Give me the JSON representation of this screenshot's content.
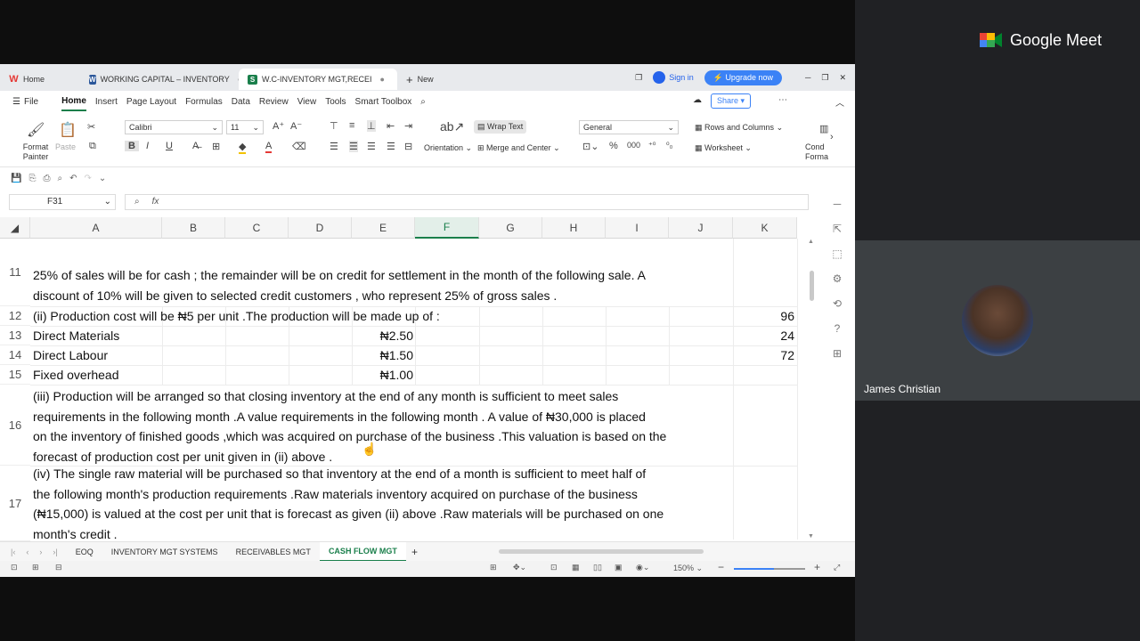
{
  "meet": {
    "brand": "Google Meet",
    "participant_name": "James Christian"
  },
  "browser": {
    "tabs": [
      {
        "label": "Home",
        "badge": "W",
        "color": "#e53935"
      },
      {
        "label": "WORKING CAPITAL – INVENTORY",
        "badge": "W",
        "color": "#2b579a"
      },
      {
        "label": "W.C-INVENTORY MGT,RECEI",
        "badge": "S",
        "color": "#1a7f4b"
      }
    ],
    "new_tab": "New",
    "sign_in": "Sign in",
    "upgrade": "Upgrade now"
  },
  "menu": {
    "file": "File",
    "items": [
      "Home",
      "Insert",
      "Page Layout",
      "Formulas",
      "Data",
      "Review",
      "View",
      "Tools",
      "Smart Toolbox"
    ],
    "share": "Share"
  },
  "ribbon": {
    "format_painter": "Format Painter",
    "paste": "Paste",
    "font_name": "Calibri",
    "font_size": "11",
    "wrap_text": "Wrap Text",
    "orientation": "Orientation",
    "merge_center": "Merge and Center",
    "number_format": "General",
    "rows_columns": "Rows and Columns",
    "worksheet": "Worksheet",
    "cond_format": "Cond Forma"
  },
  "formula_bar": {
    "cell_ref": "F31",
    "fx": "fx",
    "value": ""
  },
  "columns": [
    "A",
    "B",
    "C",
    "D",
    "E",
    "F",
    "G",
    "H",
    "I",
    "J",
    "K"
  ],
  "selected_column": "F",
  "rows": {
    "r11": {
      "num": "11",
      "lines": [
        "25% of sales will be for cash ; the remainder will be on credit for settlement in the month of the  following sale. A",
        "discount of 10% will be given to selected credit customers , who represent 25% of gross sales ."
      ]
    },
    "r12": {
      "num": "12",
      "a": "(ii) Production cost will be ₦5 per unit .The production will be made up of :",
      "k": "96"
    },
    "r13": {
      "num": "13",
      "a": "Direct Materials",
      "e": "₦2.50",
      "k": "24"
    },
    "r14": {
      "num": "14",
      "a": "Direct Labour",
      "e": "₦1.50",
      "k": "72"
    },
    "r15": {
      "num": "15",
      "a": "Fixed overhead",
      "e": "₦1.00"
    },
    "r16": {
      "num": "16",
      "lines": [
        "(iii) Production will be arranged so that closing inventory at the end of any month is sufficient to meet sales",
        "requirements in the following month .A value  requirements in the following month . A value  of ₦30,000 is placed",
        "on the inventory of finished goods ,which was acquired on purchase of the business .This valuation is based on the",
        "forecast of production cost per unit given in (ii) above ."
      ]
    },
    "r17": {
      "num": "17",
      "lines": [
        "(iv) The single raw material will be purchased so that inventory at the end of a month is sufficient to meet half of",
        "the following month's production requirements .Raw materials inventory acquired on purchase of the business",
        "(₦15,000) is valued at the cost per unit that is forecast as given (ii) above .Raw materials will be purchased on one",
        "month's credit ."
      ]
    }
  },
  "sheets": [
    "EOQ",
    "INVENTORY MGT SYSTEMS",
    "RECEIVABLES MGT",
    "CASH FLOW MGT"
  ],
  "active_sheet": "CASH FLOW MGT",
  "status": {
    "zoom": "150%",
    "zoom_level": 0.56
  }
}
